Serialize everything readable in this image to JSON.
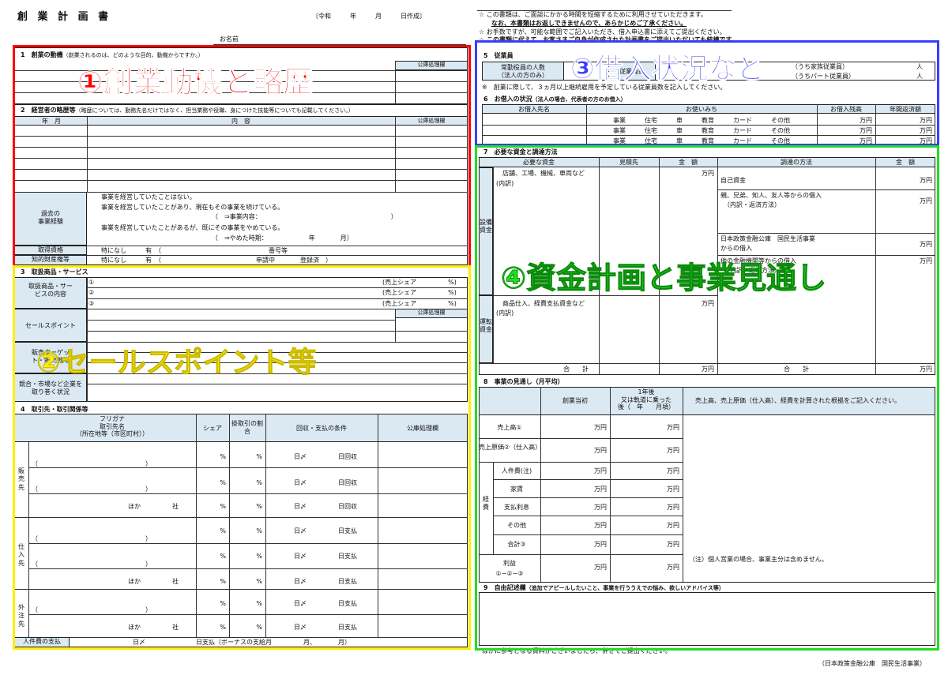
{
  "header": {
    "title": "創 業 計 画 書",
    "date_label": "〔令和　　　年　　　月　　　日作成〕",
    "name_label": "お名前"
  },
  "notes": {
    "line1": "この書類は、ご面談にかかる時間を短縮するために利用させていただきます。",
    "line2": "なお、本書類はお返しできませんので、あらかじめご了承ください。",
    "line3": "お手数ですが、可能な範囲でご記入いただき、借入申込書に添えてご提出ください。",
    "line4": "この書類に代えて、お客さまご自身が作成された計画書をご提出いただいても結構です。"
  },
  "sec1": {
    "title": "1　創業の動機",
    "hint": "（創業されるのは、どのような目的、動機からですか。）",
    "office": "公庫処理欄"
  },
  "sec2": {
    "title": "2　経営者の略歴等",
    "hint": "（略歴については、勤務先名だけではなく、担当業務や役職、身につけた技能等についても記載してください。）",
    "col_year": "年　月",
    "col_content": "内　容",
    "office": "公庫処理欄",
    "exp_label1": "過去の",
    "exp_label2": "事業経験",
    "exp1": "事業を経営していたことはない。",
    "exp2": "事業を経営していたことがあり、現在もその事業を続けている。",
    "exp2b": "（　⇒事業内容：　　　　　　　　　　　　　　　　　　　　　）",
    "exp3": "事業を経営していたことがあるが、既にその事業をやめている。",
    "exp3b": "（　⇒やめた時期：　　　　　　　年　　　　月）",
    "qual_label": "取得資格",
    "qual_text": "特になし　　　有　（　　　　　　　　　　　　　　　　　番号等",
    "ip_label": "知的財産権等",
    "ip_text": "特になし　　　有　（　　　　　　　　　　　　　　　申請中　　　　登録済　）"
  },
  "sec3": {
    "title": "3　取扱商品・サービス",
    "products_label": "取扱商品・サービスの内容",
    "items": [
      "①",
      "②",
      "③"
    ],
    "share": "(売上シェア　　　　　%)",
    "office": "公庫処理欄",
    "sales_point": "セールスポイント",
    "target": "販売ターゲット・販売戦略",
    "competition": "競合・市場など企業を取り巻く状況"
  },
  "sec4": {
    "title": "4　取引先・取引関係等",
    "col_kana": "フリガナ",
    "col_name": "取引先名",
    "col_loc": "（所在地等（市区町村））",
    "col_share": "シェア",
    "col_ratio": "掛取引の割合",
    "col_terms": "回収・支払の条件",
    "col_office": "公庫処理欄",
    "group_sales": "販売先",
    "group_supply": "仕入先",
    "group_outsource": "外注先",
    "others": "ほか　　　　　社",
    "pct": "%",
    "collect": "日〆　　　　　日回収",
    "pay": "日〆　　　　　日支払",
    "paren": "（　　　　　　　　　　　　　　　　　）",
    "payroll_label": "人件費の支払",
    "payroll_text": "日〆　　　　　　　　日支払（ボーナスの支給月　　　　　月、　　　　月）"
  },
  "sec5": {
    "title": "5　従業員",
    "label1": "常勤役員の人数",
    "label2": "（法人の方のみ）",
    "employees": "従業員数",
    "family": "（うち家族従業員）",
    "part": "（うちパート従業員）",
    "unit": "人",
    "note": "※　創業に際して、３ヵ月以上継続雇用を予定している従業員数を記入してください。"
  },
  "sec6": {
    "title": "6　お借入の状況",
    "hint": "（法人の場合、代表者の方のお借入）",
    "col_lender": "お借入先名",
    "col_use": "お使いみち",
    "col_balance": "お借入残高",
    "col_repay": "年間返済額",
    "use_line": "事業　　　住宅　　　車　　　教育　　　カード　　　その他",
    "man": "万円"
  },
  "sec7": {
    "title": "7　必要な資金と調達方法",
    "col_need": "必要な資金",
    "col_est": "見積先",
    "col_amount": "金　額",
    "col_method": "調達の方法",
    "col_amount2": "金　額",
    "equip_label": "設備資金",
    "equip_text": "店舗、工場、機械、車両など",
    "breakdown": "(内訳)",
    "op_label": "運転資金",
    "op_text": "商品仕入、経費支払資金など",
    "total": "合　　計",
    "self": "自己資金",
    "family": "親、兄弟、知人、友人等からの借入",
    "family_sub": "（内訳・返済方法）",
    "jfc": "日本政策金融公庫　国民生活事業",
    "jfc_sub": "からの借入",
    "other_bank": "他の金融機関等からの借入",
    "other_bank_sub": "（内訳・返済方法）",
    "man": "万円"
  },
  "sec8": {
    "title": "8　事業の見通し（月平均）",
    "col_start": "創業当初",
    "col_after1": "1年後",
    "col_after2": "又は軌道に乗った",
    "col_after3": "後（　年　　月頃）",
    "col_basis": "売上高、売上原価（仕入高）、経費を計算された根拠をご記入ください。",
    "rows": [
      "売上高①",
      "売上原価②（仕入高）",
      "人件費(注)",
      "家賃",
      "支払利息",
      "その他",
      "合計③",
      "利益　①−②−③"
    ],
    "expense_label": "経費",
    "man": "万円",
    "note": "（注）個人営業の場合、事業主分は含めません。"
  },
  "sec9": {
    "title": "9　自由記述欄",
    "hint": "（追加でアピールしたいこと、事業を行ううえでの悩み、欲しいアドバイス等）",
    "footer": "ほかに参考となる資料がございましたら、併せてご提出ください。"
  },
  "footer": {
    "publisher": "（日本政策金融公庫　国民生活事業）"
  },
  "overlays": {
    "o1": "①創業動機と略歴",
    "o2": "②セールスポイント等",
    "o3": "③借入状況など",
    "o4": "④資金計画と事業見通し"
  },
  "colors": {
    "red": "#ff0000",
    "yellow": "#ffee00",
    "blue": "#3b3bff",
    "green": "#22dd22",
    "shade": "#dbe9f3"
  }
}
